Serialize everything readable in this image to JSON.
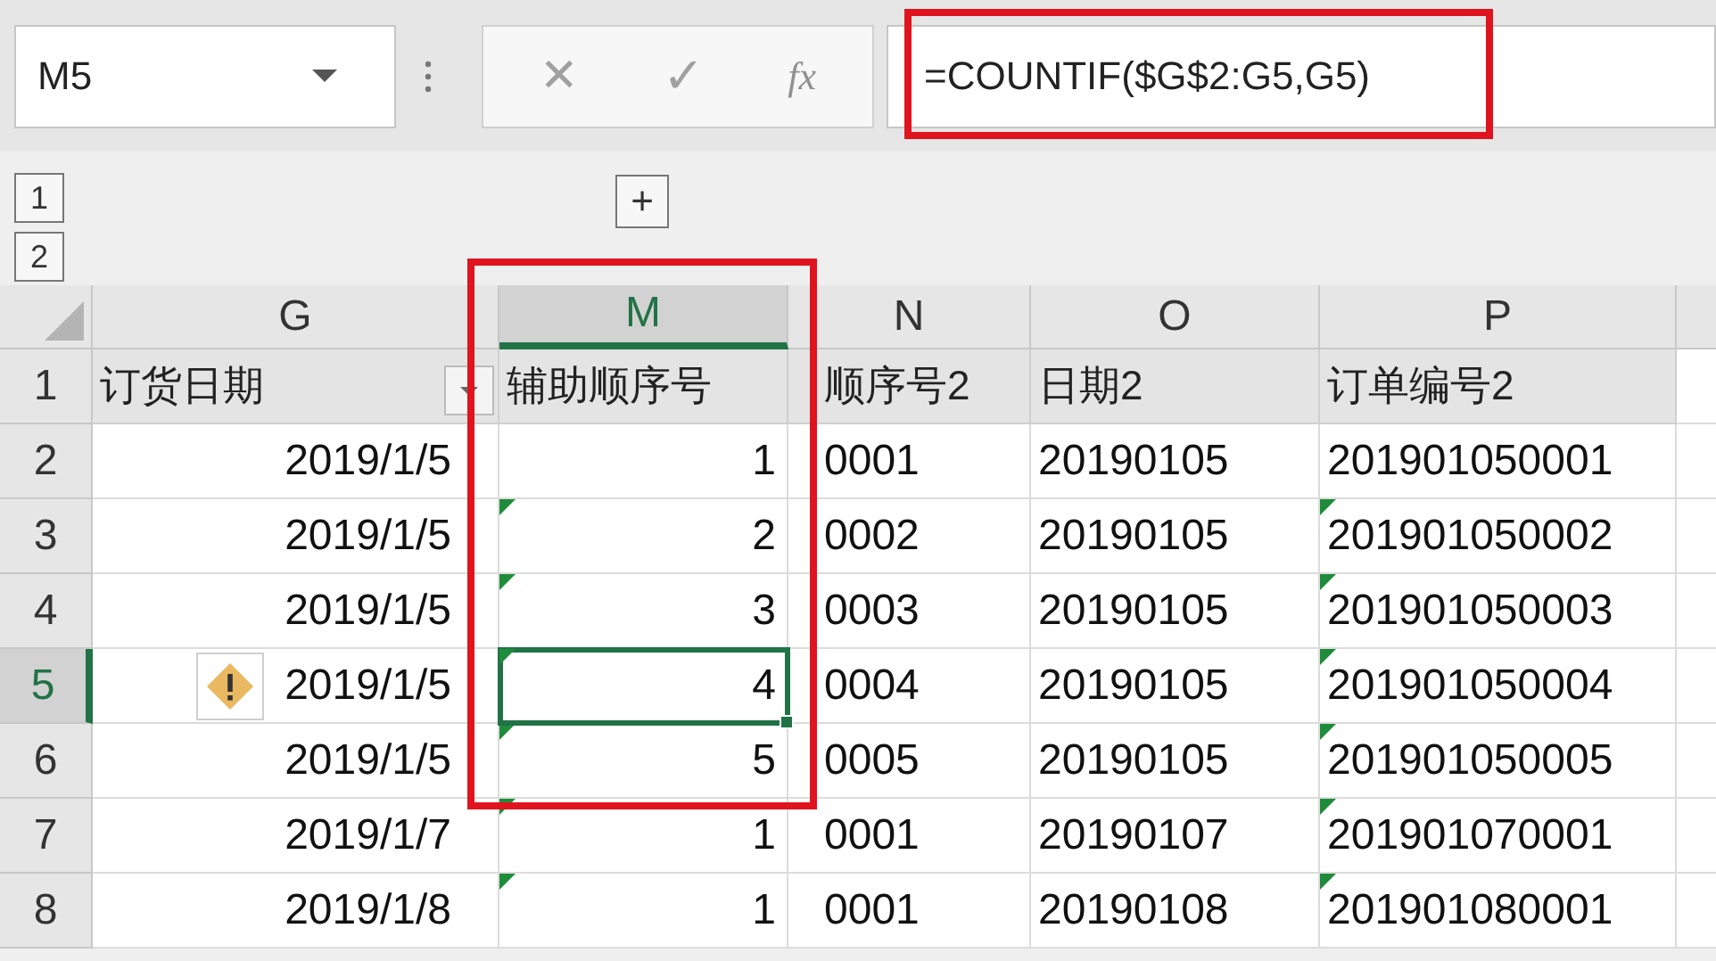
{
  "name_box": {
    "value": "M5"
  },
  "formula_bar": {
    "cancel": "✕",
    "enter": "✓",
    "function": "fx",
    "formula": "=COUNTIF($G$2:G5,G5)",
    "highlighted": true
  },
  "outline": {
    "levels": [
      "1",
      "2"
    ],
    "expand": "+"
  },
  "columns": [
    {
      "letter": "G",
      "selected": false,
      "highlighted": false
    },
    {
      "letter": "M",
      "selected": true,
      "highlighted": true
    },
    {
      "letter": "N",
      "selected": false,
      "highlighted": false
    },
    {
      "letter": "O",
      "selected": false,
      "highlighted": false
    },
    {
      "letter": "P",
      "selected": false,
      "highlighted": false
    }
  ],
  "header_row": {
    "number": "1",
    "cells": [
      {
        "text": "订货日期",
        "filter": true
      },
      {
        "text": "辅助顺序号",
        "filter": false
      },
      {
        "text": "顺序号2",
        "filter": false
      },
      {
        "text": "日期2",
        "filter": false
      },
      {
        "text": "订单编号2",
        "filter": false
      }
    ]
  },
  "rows": [
    {
      "number": "2",
      "selected": false,
      "cells": [
        {
          "text": "2019/1/5",
          "flag": false
        },
        {
          "text": "1",
          "flag": false
        },
        {
          "text": "0001",
          "flag": false
        },
        {
          "text": "20190105",
          "flag": false
        },
        {
          "text": "201901050001",
          "flag": false
        }
      ]
    },
    {
      "number": "3",
      "selected": false,
      "cells": [
        {
          "text": "2019/1/5",
          "flag": false
        },
        {
          "text": "2",
          "flag": true
        },
        {
          "text": "0002",
          "flag": false
        },
        {
          "text": "20190105",
          "flag": false
        },
        {
          "text": "201901050002",
          "flag": true
        }
      ]
    },
    {
      "number": "4",
      "selected": false,
      "cells": [
        {
          "text": "2019/1/5",
          "flag": false
        },
        {
          "text": "3",
          "flag": true
        },
        {
          "text": "0003",
          "flag": false
        },
        {
          "text": "20190105",
          "flag": false
        },
        {
          "text": "201901050003",
          "flag": true
        }
      ]
    },
    {
      "number": "5",
      "selected": true,
      "cells": [
        {
          "text": "2019/1/5",
          "flag": false,
          "warning": true
        },
        {
          "text": "4",
          "flag": true,
          "active": true
        },
        {
          "text": "0004",
          "flag": false
        },
        {
          "text": "20190105",
          "flag": false
        },
        {
          "text": "201901050004",
          "flag": true
        }
      ]
    },
    {
      "number": "6",
      "selected": false,
      "cells": [
        {
          "text": "2019/1/5",
          "flag": false
        },
        {
          "text": "5",
          "flag": true
        },
        {
          "text": "0005",
          "flag": false
        },
        {
          "text": "20190105",
          "flag": false
        },
        {
          "text": "201901050005",
          "flag": true
        }
      ]
    },
    {
      "number": "7",
      "selected": false,
      "cells": [
        {
          "text": "2019/1/7",
          "flag": false
        },
        {
          "text": "1",
          "flag": true
        },
        {
          "text": "0001",
          "flag": false
        },
        {
          "text": "20190107",
          "flag": false
        },
        {
          "text": "201901070001",
          "flag": true
        }
      ]
    },
    {
      "number": "8",
      "selected": false,
      "cells": [
        {
          "text": "2019/1/8",
          "flag": false
        },
        {
          "text": "1",
          "flag": true
        },
        {
          "text": "0001",
          "flag": false
        },
        {
          "text": "20190108",
          "flag": false
        },
        {
          "text": "201901080001",
          "flag": true
        }
      ]
    }
  ]
}
